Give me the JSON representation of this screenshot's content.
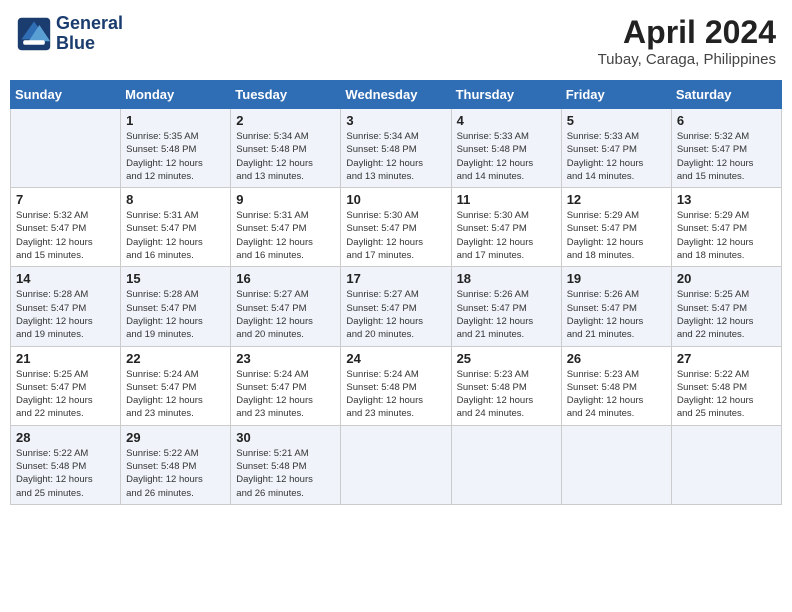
{
  "header": {
    "logo_line1": "General",
    "logo_line2": "Blue",
    "month": "April 2024",
    "location": "Tubay, Caraga, Philippines"
  },
  "days_of_week": [
    "Sunday",
    "Monday",
    "Tuesday",
    "Wednesday",
    "Thursday",
    "Friday",
    "Saturday"
  ],
  "weeks": [
    [
      {
        "day": "",
        "info": ""
      },
      {
        "day": "1",
        "info": "Sunrise: 5:35 AM\nSunset: 5:48 PM\nDaylight: 12 hours\nand 12 minutes."
      },
      {
        "day": "2",
        "info": "Sunrise: 5:34 AM\nSunset: 5:48 PM\nDaylight: 12 hours\nand 13 minutes."
      },
      {
        "day": "3",
        "info": "Sunrise: 5:34 AM\nSunset: 5:48 PM\nDaylight: 12 hours\nand 13 minutes."
      },
      {
        "day": "4",
        "info": "Sunrise: 5:33 AM\nSunset: 5:48 PM\nDaylight: 12 hours\nand 14 minutes."
      },
      {
        "day": "5",
        "info": "Sunrise: 5:33 AM\nSunset: 5:47 PM\nDaylight: 12 hours\nand 14 minutes."
      },
      {
        "day": "6",
        "info": "Sunrise: 5:32 AM\nSunset: 5:47 PM\nDaylight: 12 hours\nand 15 minutes."
      }
    ],
    [
      {
        "day": "7",
        "info": "Sunrise: 5:32 AM\nSunset: 5:47 PM\nDaylight: 12 hours\nand 15 minutes."
      },
      {
        "day": "8",
        "info": "Sunrise: 5:31 AM\nSunset: 5:47 PM\nDaylight: 12 hours\nand 16 minutes."
      },
      {
        "day": "9",
        "info": "Sunrise: 5:31 AM\nSunset: 5:47 PM\nDaylight: 12 hours\nand 16 minutes."
      },
      {
        "day": "10",
        "info": "Sunrise: 5:30 AM\nSunset: 5:47 PM\nDaylight: 12 hours\nand 17 minutes."
      },
      {
        "day": "11",
        "info": "Sunrise: 5:30 AM\nSunset: 5:47 PM\nDaylight: 12 hours\nand 17 minutes."
      },
      {
        "day": "12",
        "info": "Sunrise: 5:29 AM\nSunset: 5:47 PM\nDaylight: 12 hours\nand 18 minutes."
      },
      {
        "day": "13",
        "info": "Sunrise: 5:29 AM\nSunset: 5:47 PM\nDaylight: 12 hours\nand 18 minutes."
      }
    ],
    [
      {
        "day": "14",
        "info": "Sunrise: 5:28 AM\nSunset: 5:47 PM\nDaylight: 12 hours\nand 19 minutes."
      },
      {
        "day": "15",
        "info": "Sunrise: 5:28 AM\nSunset: 5:47 PM\nDaylight: 12 hours\nand 19 minutes."
      },
      {
        "day": "16",
        "info": "Sunrise: 5:27 AM\nSunset: 5:47 PM\nDaylight: 12 hours\nand 20 minutes."
      },
      {
        "day": "17",
        "info": "Sunrise: 5:27 AM\nSunset: 5:47 PM\nDaylight: 12 hours\nand 20 minutes."
      },
      {
        "day": "18",
        "info": "Sunrise: 5:26 AM\nSunset: 5:47 PM\nDaylight: 12 hours\nand 21 minutes."
      },
      {
        "day": "19",
        "info": "Sunrise: 5:26 AM\nSunset: 5:47 PM\nDaylight: 12 hours\nand 21 minutes."
      },
      {
        "day": "20",
        "info": "Sunrise: 5:25 AM\nSunset: 5:47 PM\nDaylight: 12 hours\nand 22 minutes."
      }
    ],
    [
      {
        "day": "21",
        "info": "Sunrise: 5:25 AM\nSunset: 5:47 PM\nDaylight: 12 hours\nand 22 minutes."
      },
      {
        "day": "22",
        "info": "Sunrise: 5:24 AM\nSunset: 5:47 PM\nDaylight: 12 hours\nand 23 minutes."
      },
      {
        "day": "23",
        "info": "Sunrise: 5:24 AM\nSunset: 5:47 PM\nDaylight: 12 hours\nand 23 minutes."
      },
      {
        "day": "24",
        "info": "Sunrise: 5:24 AM\nSunset: 5:48 PM\nDaylight: 12 hours\nand 23 minutes."
      },
      {
        "day": "25",
        "info": "Sunrise: 5:23 AM\nSunset: 5:48 PM\nDaylight: 12 hours\nand 24 minutes."
      },
      {
        "day": "26",
        "info": "Sunrise: 5:23 AM\nSunset: 5:48 PM\nDaylight: 12 hours\nand 24 minutes."
      },
      {
        "day": "27",
        "info": "Sunrise: 5:22 AM\nSunset: 5:48 PM\nDaylight: 12 hours\nand 25 minutes."
      }
    ],
    [
      {
        "day": "28",
        "info": "Sunrise: 5:22 AM\nSunset: 5:48 PM\nDaylight: 12 hours\nand 25 minutes."
      },
      {
        "day": "29",
        "info": "Sunrise: 5:22 AM\nSunset: 5:48 PM\nDaylight: 12 hours\nand 26 minutes."
      },
      {
        "day": "30",
        "info": "Sunrise: 5:21 AM\nSunset: 5:48 PM\nDaylight: 12 hours\nand 26 minutes."
      },
      {
        "day": "",
        "info": ""
      },
      {
        "day": "",
        "info": ""
      },
      {
        "day": "",
        "info": ""
      },
      {
        "day": "",
        "info": ""
      }
    ]
  ]
}
